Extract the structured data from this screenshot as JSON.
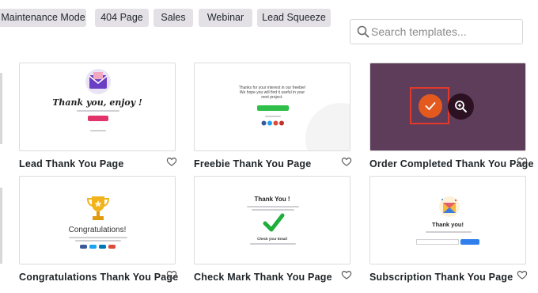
{
  "filters": [
    "Maintenance Mode",
    "404 Page",
    "Sales",
    "Webinar",
    "Lead Squeeze"
  ],
  "search": {
    "placeholder": "Search templates..."
  },
  "templates": [
    {
      "title": "Lead Thank You Page"
    },
    {
      "title": "Freebie Thank You Page"
    },
    {
      "title": "Order Completed Thank You Page"
    },
    {
      "title": "Congratulations Thank You Page"
    },
    {
      "title": "Check Mark Thank You Page"
    },
    {
      "title": "Subscription Thank You Page"
    }
  ],
  "thumbs": {
    "lead": {
      "heading": "Thank you, enjoy !"
    },
    "freebie": {
      "line1": "Thanks for your interest in our freebie!",
      "line2": "We hope you will find it useful in your",
      "line3": "next project."
    },
    "congrats": {
      "heading": "Congratulations!"
    },
    "checkmark": {
      "heading": "Thank You !",
      "sub": "Check your Email"
    },
    "subscription": {
      "heading": "Thank you!"
    }
  },
  "colors": {
    "chip_bg": "#e3e1e6",
    "order_thumb_bg": "#5e3d5b",
    "select_check": "#e45a1e",
    "select_border": "#e2392a",
    "zoom_button": "#2b1121",
    "check_green": "#1fae3c",
    "lead_pink": "#e3336b"
  },
  "icons": {
    "search": "search-icon",
    "heart": "heart-outline-icon",
    "check": "checkmark-icon",
    "zoom": "zoom-in-icon"
  }
}
